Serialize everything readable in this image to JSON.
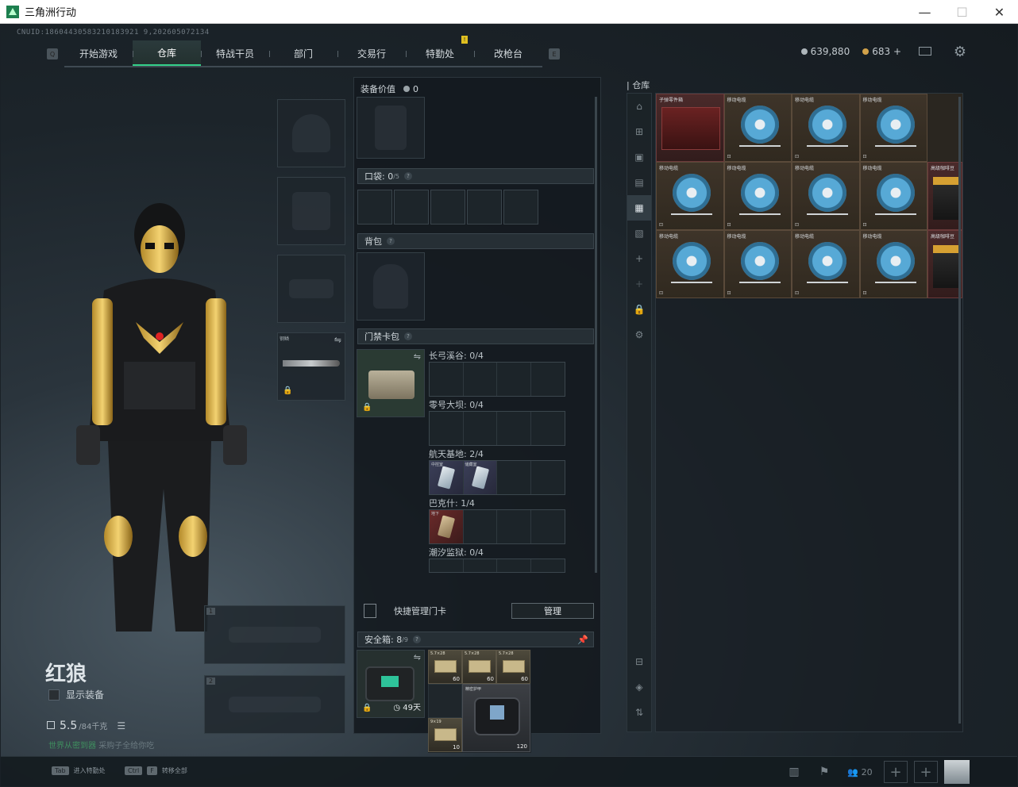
{
  "window": {
    "title": "三角洲行动",
    "minimize": "—",
    "maximize": "☐",
    "close": "✕"
  },
  "cnuid": "CNUID:18604430583210183921 9,202605072134",
  "nav": {
    "left_key": "Q",
    "right_key": "E",
    "tabs": [
      {
        "label": "开始游戏",
        "active": false
      },
      {
        "label": "仓库",
        "active": true
      },
      {
        "label": "特战干员",
        "active": false
      },
      {
        "label": "部门",
        "active": false
      },
      {
        "label": "交易行",
        "active": false
      },
      {
        "label": "特勤处",
        "active": false,
        "badge": "!"
      },
      {
        "label": "改枪台",
        "active": false
      }
    ]
  },
  "currency": {
    "silver": "639,880",
    "gold": "683",
    "add": "+",
    "silver_color": "#aeb6bb",
    "gold_color": "#d2a24a"
  },
  "character": {
    "name": "红狼",
    "show_equipment": "显示装备",
    "weight": "5.5",
    "weight_max": "/84千克",
    "slogan_pre": "世界",
    "slogan_hl": "从密到器",
    "slogan_post": "采购子全给你吃"
  },
  "equip_slots": {
    "melee_tag": "钢鳞",
    "weapon_1": "1",
    "weapon_2": "2"
  },
  "loadout": {
    "equip_value_label": "装备价值",
    "equip_value": "0",
    "pocket_label": "口袋:",
    "pocket_value": "0",
    "pocket_max": "/5",
    "backpack_label": "背包",
    "keycard_label": "门禁卡包",
    "keycard_rows": [
      {
        "label": "长弓溪谷: 0/4"
      },
      {
        "label": "零号大坝: 0/4"
      },
      {
        "label": "航天基地: 2/4",
        "items": [
          "中控室",
          "储藏室"
        ]
      },
      {
        "label": "巴克什: 1/4",
        "items": [
          "地下"
        ]
      },
      {
        "label": "潮汐监狱: 0/4"
      }
    ],
    "quick_manage": "快捷管理门卡",
    "manage_btn": "管理",
    "safebox_label": "安全箱:",
    "safebox_value": "8",
    "safebox_max": "/9",
    "safebox_days": "49天",
    "safebox_items": [
      {
        "label": "5.7×28",
        "count": "60"
      },
      {
        "label": "5.7×28",
        "count": "60"
      },
      {
        "label": "5.7×28",
        "count": "60"
      },
      {
        "label": "9×19",
        "count": "10"
      }
    ],
    "armor_label": "精密护甲",
    "armor_count": "120"
  },
  "warehouse": {
    "title": "仓库",
    "items": [
      {
        "label": "子弹零件箱"
      },
      {
        "label": "移动电缆"
      },
      {
        "label": "移动电缆"
      },
      {
        "label": "移动电缆"
      },
      {
        "label": "移动电缆"
      },
      {
        "label": "移动电缆"
      },
      {
        "label": "移动电缆"
      },
      {
        "label": "移动电缆"
      },
      {
        "label": "高级咖啡豆"
      },
      {
        "label": "移动电缆"
      },
      {
        "label": "移动电缆"
      },
      {
        "label": "移动电缆"
      },
      {
        "label": "移动电缆"
      },
      {
        "label": "高级咖啡豆"
      }
    ]
  },
  "bottom": {
    "hint1_key": "Tab",
    "hint1": "进入特勤处",
    "hint2_key": "Ctrl",
    "hint2_key2": "F",
    "hint2": "转移全部",
    "friends": "20",
    "thumb_count": "0"
  }
}
